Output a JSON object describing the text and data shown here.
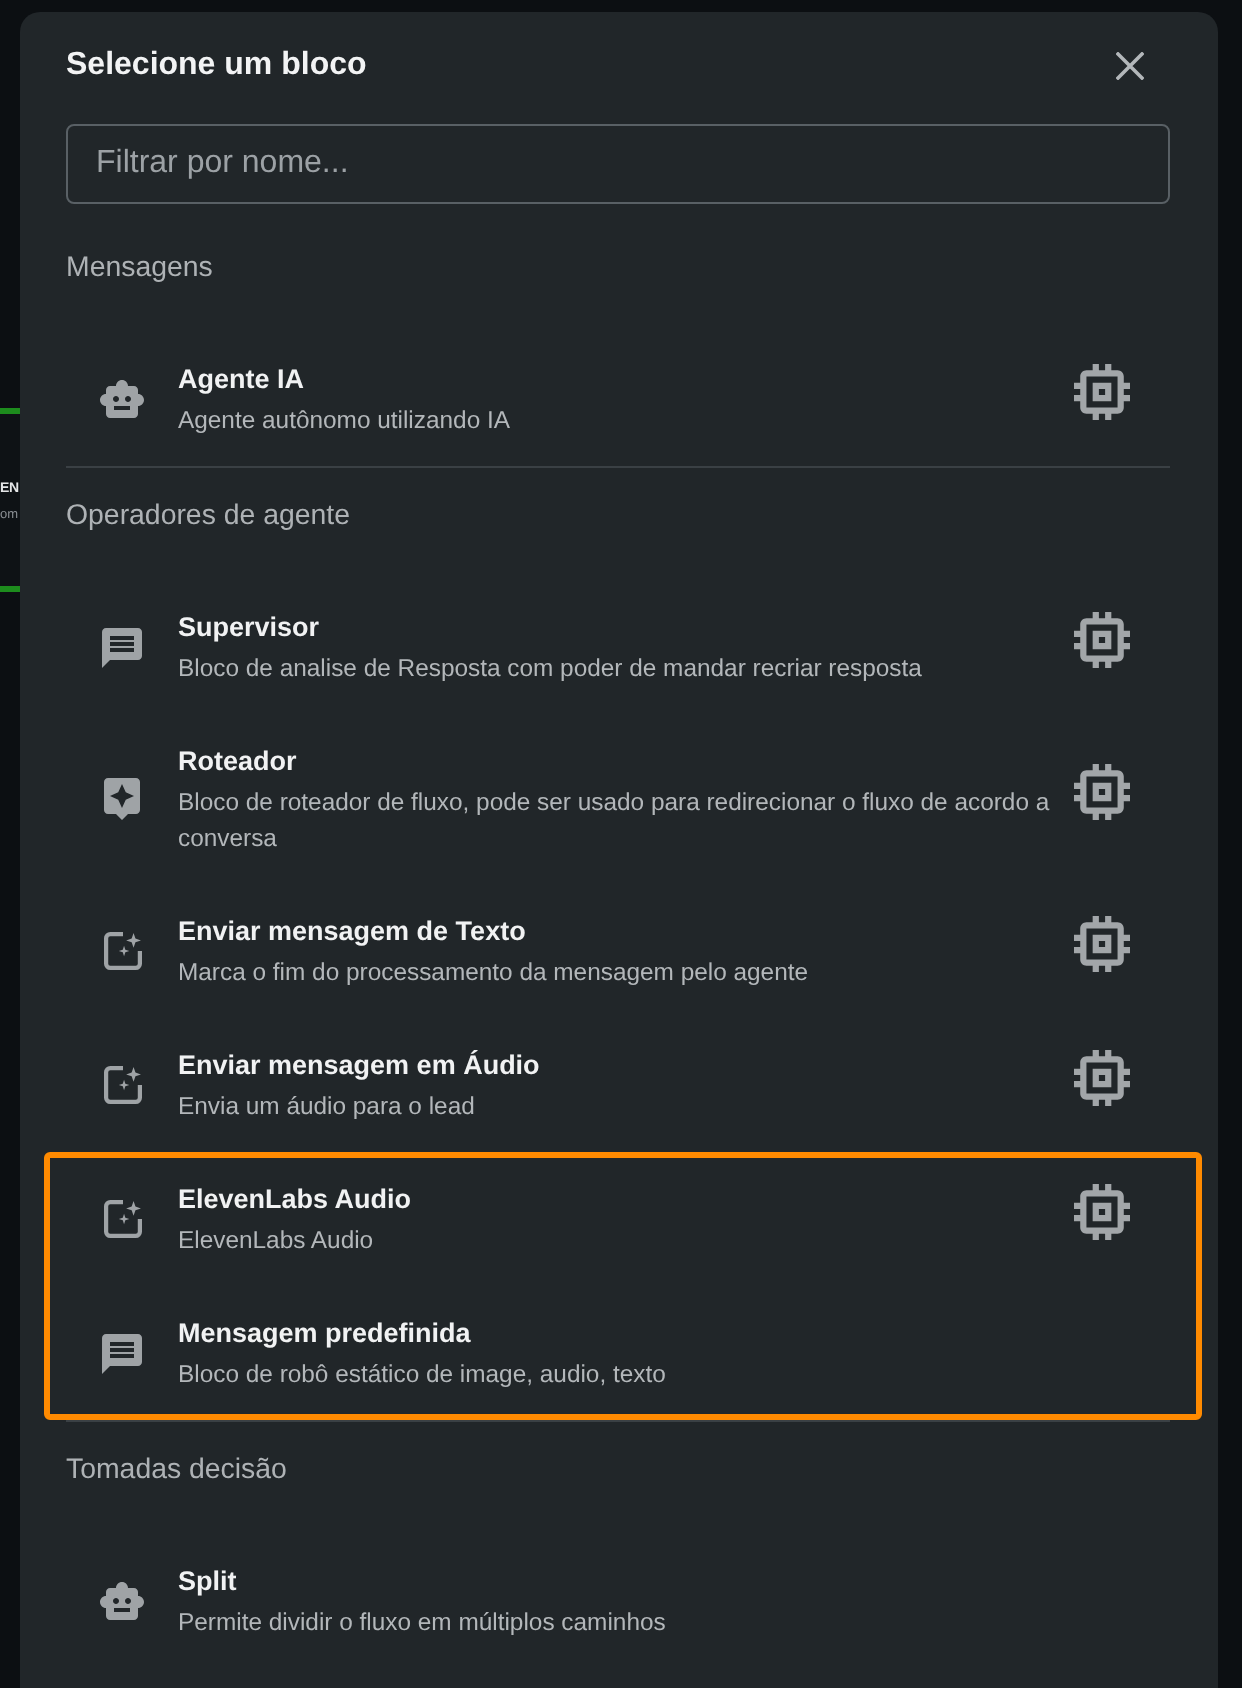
{
  "background_node": {
    "title": "EN",
    "subtitle": "om"
  },
  "dialog": {
    "title": "Selecione um bloco",
    "filter": {
      "placeholder": "Filtrar por nome..."
    }
  },
  "sections": [
    {
      "title": "Mensagens",
      "items": [
        {
          "kind": "robot",
          "name": "Agente IA",
          "description": "Agente autônomo utilizando IA",
          "chip": true,
          "highlighted": false
        }
      ]
    },
    {
      "title": "Operadores de agente",
      "items": [
        {
          "kind": "message",
          "name": "Supervisor",
          "description": "Bloco de analise de Resposta com poder de mandar recriar resposta",
          "chip": true,
          "highlighted": false
        },
        {
          "kind": "assistant",
          "name": "Roteador",
          "description": "Bloco de roteador de fluxo, pode ser usado para redirecionar o fluxo de acordo a conversa",
          "chip": true,
          "highlighted": false
        },
        {
          "kind": "sparkle",
          "name": "Enviar mensagem de Texto",
          "description": "Marca o fim do processamento da mensagem pelo agente",
          "chip": true,
          "highlighted": false
        },
        {
          "kind": "sparkle",
          "name": "Enviar mensagem em Áudio",
          "description": "Envia um áudio para o lead",
          "chip": true,
          "highlighted": false
        },
        {
          "kind": "sparkle",
          "name": "ElevenLabs Audio",
          "description": "ElevenLabs Audio",
          "chip": true,
          "highlighted": true
        },
        {
          "kind": "message",
          "name": "Mensagem predefinida",
          "description": "Bloco de robô estático de image, audio, texto",
          "chip": false,
          "highlighted": true
        }
      ]
    },
    {
      "title": "Tomadas decisão",
      "items": [
        {
          "kind": "robot",
          "name": "Split",
          "description": "Permite dividir o fluxo em múltiplos caminhos",
          "chip": false,
          "highlighted": false
        }
      ]
    }
  ]
}
